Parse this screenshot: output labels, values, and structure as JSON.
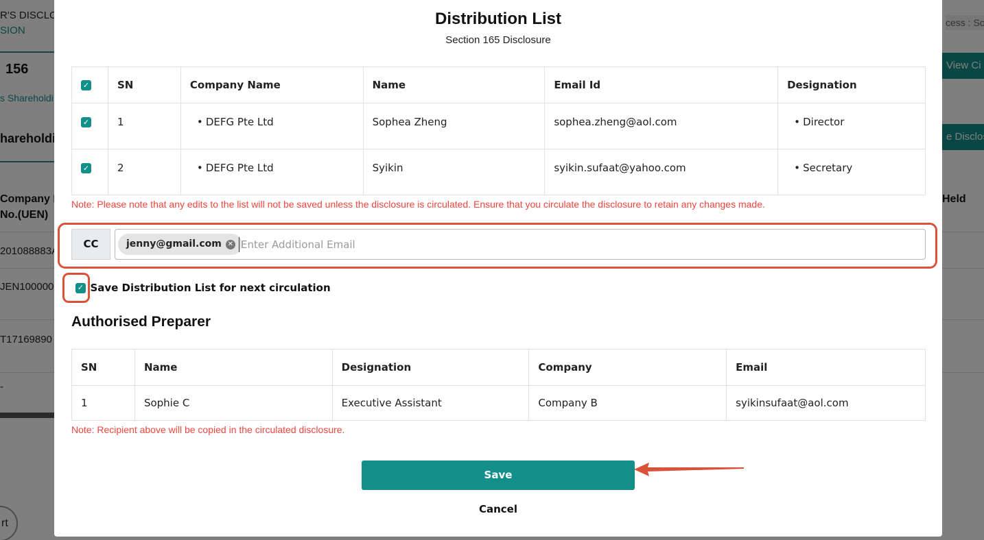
{
  "background": {
    "title_fragment": "R'S DISCLO",
    "subtitle_fragment": "SION",
    "count": "156",
    "tab_fragment": "s Shareholdi",
    "section_fragment": "hareholdi",
    "column_fragment_1": "Company R",
    "column_fragment_2": "No.(UEN)",
    "row_1": "201088883A",
    "row_2": "JEN100000",
    "row_3": "T17169890",
    "row_4": "-",
    "access_fragment": "cess : So",
    "view_button_fragment": "View Ci",
    "disclose_button_fragment": "e Disclos",
    "held_fragment": "Held",
    "circle_fragment": "rt"
  },
  "modal": {
    "title": "Distribution List",
    "subtitle": "Section 165 Disclosure",
    "distribution_table": {
      "headers": [
        "SN",
        "Company Name",
        "Name",
        "Email Id",
        "Designation"
      ],
      "rows": [
        {
          "checked": true,
          "sn": "1",
          "company": "DEFG Pte Ltd",
          "name": "Sophea Zheng",
          "email": "sophea.zheng@aol.com",
          "designation": "Director"
        },
        {
          "checked": true,
          "sn": "2",
          "company": "DEFG Pte Ltd",
          "name": "Syikin",
          "email": "syikin.sufaat@yahoo.com",
          "designation": "Secretary"
        }
      ]
    },
    "note_edits": "Note: Please note that any edits to the list will not be saved unless the disclosure is circulated. Ensure that you circulate the disclosure to retain any changes made.",
    "cc": {
      "label": "CC",
      "chip": "jenny@gmail.com",
      "placeholder": "Enter Additional Email"
    },
    "save_distribution_label": "Save Distribution List for next circulation",
    "authorised_heading": "Authorised Preparer",
    "preparer_table": {
      "headers": [
        "SN",
        "Name",
        "Designation",
        "Company",
        "Email"
      ],
      "rows": [
        {
          "sn": "1",
          "name": "Sophie C",
          "designation": "Executive Assistant",
          "company": "Company B",
          "email": "syikinsufaat@aol.com"
        }
      ]
    },
    "note_recipient": "Note: Recipient above will be copied in the circulated disclosure.",
    "save_label": "Save",
    "cancel_label": "Cancel"
  },
  "icons": {
    "checkbox": "checkbox-checked-icon",
    "remove_chip": "close-circle-icon",
    "annotation_arrow": "arrow-left-icon"
  },
  "colors": {
    "accent": "#138f8a",
    "note": "#f0453d",
    "annotation": "#d9533b"
  }
}
